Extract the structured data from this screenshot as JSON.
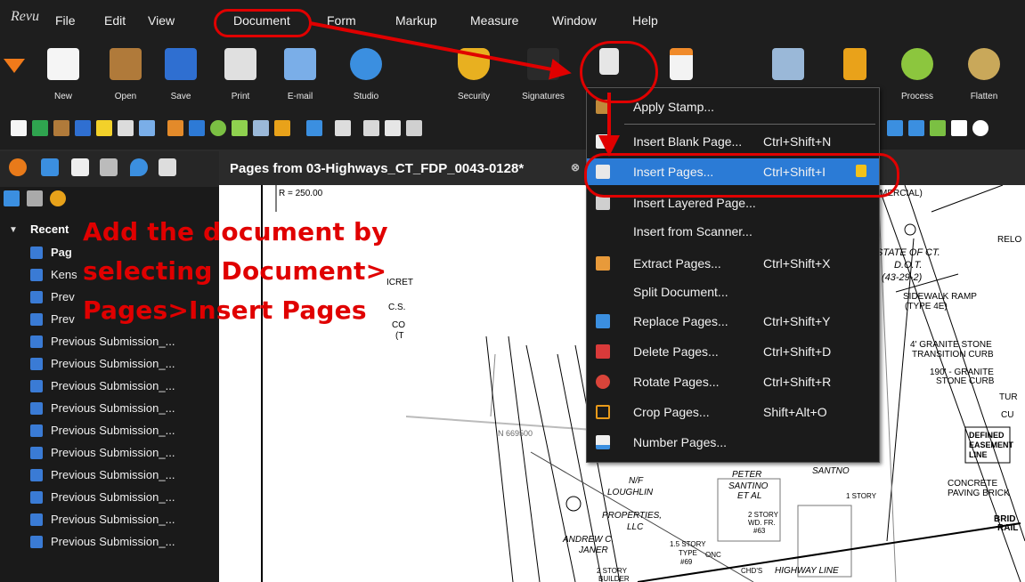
{
  "app": {
    "logo": "Revu"
  },
  "menubar": {
    "items": [
      "File",
      "Edit",
      "View",
      "Document",
      "Form",
      "Markup",
      "Measure",
      "Window",
      "Help"
    ]
  },
  "toolbar": {
    "labels": {
      "new": "New",
      "open": "Open",
      "save": "Save",
      "print": "Print",
      "email": "E-mail",
      "studio": "Studio",
      "security": "Security",
      "signatures": "Signatures",
      "process": "Process",
      "flatten": "Flatten"
    }
  },
  "document_tab": {
    "title": "Pages from 03-Highways_CT_FDP_0043-0128*",
    "close": "⊗"
  },
  "panel": {
    "recent_label": "Recent",
    "files": [
      "Pag",
      "Kens",
      "Prev",
      "Prev",
      "Previous Submission_...",
      "Previous Submission_...",
      "Previous Submission_...",
      "Previous Submission_...",
      "Previous Submission_...",
      "Previous Submission_...",
      "Previous Submission_...",
      "Previous Submission_...",
      "Previous Submission_...",
      "Previous Submission_..."
    ]
  },
  "callout": {
    "line1": "Add the document by",
    "line2": "selecting Document>",
    "line3": "Pages>Insert Pages"
  },
  "document_menu": {
    "items": [
      {
        "label": "Apply Stamp...",
        "shortcut": ""
      },
      {
        "label": "Insert Blank Page...",
        "shortcut": "Ctrl+Shift+N"
      },
      {
        "label": "Insert Pages...",
        "shortcut": "Ctrl+Shift+I"
      },
      {
        "label": "Insert Layered Page...",
        "shortcut": ""
      },
      {
        "label": "Insert from Scanner...",
        "shortcut": ""
      },
      {
        "label": "Extract Pages...",
        "shortcut": "Ctrl+Shift+X"
      },
      {
        "label": "Split Document...",
        "shortcut": ""
      },
      {
        "label": "Replace Pages...",
        "shortcut": "Ctrl+Shift+Y"
      },
      {
        "label": "Delete Pages...",
        "shortcut": "Ctrl+Shift+D"
      },
      {
        "label": "Rotate Pages...",
        "shortcut": "Ctrl+Shift+R"
      },
      {
        "label": "Crop Pages...",
        "shortcut": "Shift+Alt+O"
      },
      {
        "label": "Number Pages...",
        "shortcut": ""
      }
    ]
  },
  "drawing": {
    "texts": [
      "R = 250.00",
      "MERCIAL)",
      "ICRET",
      "C.S.",
      "CO",
      "(T",
      "N 669500",
      "STATE OF CT.",
      "D.O.T.",
      "(43-29-2)",
      "SIDEWALK RAMP",
      "(TYPE 4E)",
      "4' GRANITE STONE",
      "TRANSITION CURB",
      "190' - GRANITE",
      "STONE CURB",
      "RELO",
      "TUR",
      "CU",
      "DEFINED",
      "EASEMENT",
      "LINE",
      "PETER",
      "SANTINO",
      "SANTNO",
      "N/F",
      "LOUGHLIN",
      "ET AL",
      "PROPERTIES,",
      "LLC",
      "2 STORY",
      "WD. FR.",
      "#63",
      "1 STORY",
      "ANDREW C.",
      "JANER",
      "1.5 STORY",
      "TYPE",
      "#69",
      "CONCRETE",
      "PAVING BRICK",
      "BRID",
      "RAIL",
      "HIGHWAY LINE",
      "2 STORY",
      "BUILDER",
      "CHD'S",
      "ONC"
    ]
  },
  "colors": {
    "accent_red": "#e00000",
    "highlight": "#2b7bd6",
    "menubar_bg": "#1e1e1e",
    "panel_bg": "#1a1a1a"
  }
}
